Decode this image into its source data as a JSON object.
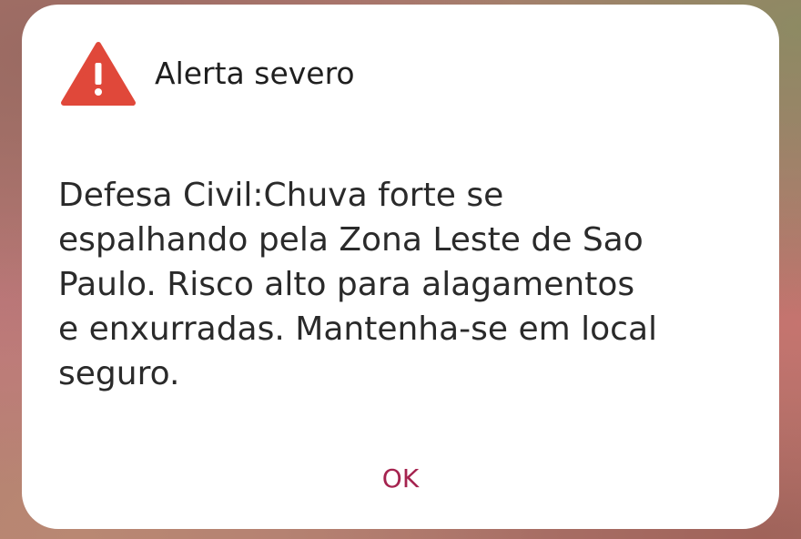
{
  "dialog": {
    "icon": "warning-triangle-icon",
    "title": "Alerta severo",
    "message": "Defesa Civil:Chuva forte se\nespalhando pela Zona Leste de Sao\nPaulo. Risco alto para alagamentos\ne enxurradas. Mantenha-se em local\nseguro.",
    "ok_label": "OK"
  },
  "colors": {
    "icon_red": "#e0483a",
    "button_accent": "#a5234f",
    "dialog_background": "#ffffff"
  }
}
